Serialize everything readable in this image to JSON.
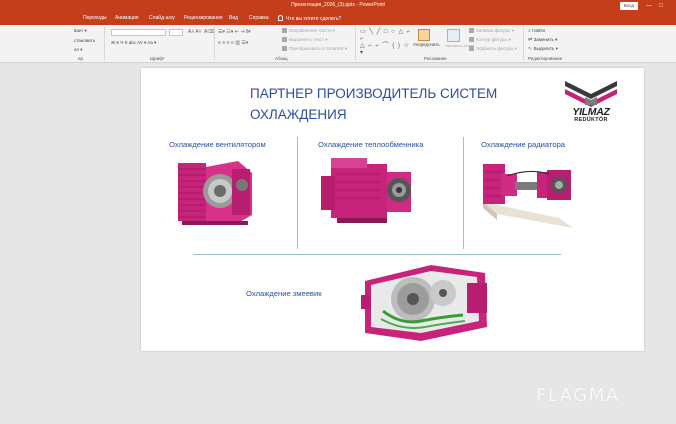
{
  "window": {
    "title": "Презентация_2026_(3).pptx  -  PowerPoint",
    "signin": "Вход",
    "accent": "#c43e1c"
  },
  "tabs": [
    "Переходы",
    "Анимация",
    "Слайд-шоу",
    "Рецензирование",
    "Вид",
    "Справка"
  ],
  "tellme": "Что вы хотите сделать?",
  "ribbon": {
    "clipboard_items": [
      "вает ▾",
      "становить",
      "ел ▾"
    ],
    "font_controls": "Ж  К  Ч  S  abc  AV ▾  Aa ▾",
    "paragraph_items": [
      "Направление текста ▾",
      "Выровнять текст ▾",
      "Преобразовать в SmartArt ▾"
    ],
    "arrange_label": "Упорядочить",
    "quick_styles_label": "Экспресс-стили",
    "shape_fill": "Заливка фигуры ▾",
    "shape_outline": "Контур фигуры ▾",
    "shape_effects": "Эффекты фигуры ▾",
    "find": "Найти",
    "replace": "Заменить ▾",
    "select": "Выделить ▾",
    "groups": {
      "clipboard": "ер",
      "font": "Шрифт",
      "paragraph": "Абзац",
      "drawing": "Рисование",
      "editing": "Редактирование"
    }
  },
  "slide": {
    "title": "ПАРТНЕР ПРОИЗВОДИТЕЛЬ СИСТЕМ ОХЛАЖДЕНИЯ",
    "logo_line1": "YILMAZ",
    "logo_line2": "REDÜKTÖR",
    "captions": {
      "fan": "Охлаждение вентилятором",
      "exchanger": "Охлаждение теплообменника",
      "radiator": "Охлаждение радиатора",
      "coil": "Охлаждение змеевик"
    }
  },
  "watermark": "FLAGMA",
  "colors": {
    "product_magenta": "#c8237a",
    "title_blue": "#2b4fa0",
    "divider": "#9cc0d6"
  }
}
